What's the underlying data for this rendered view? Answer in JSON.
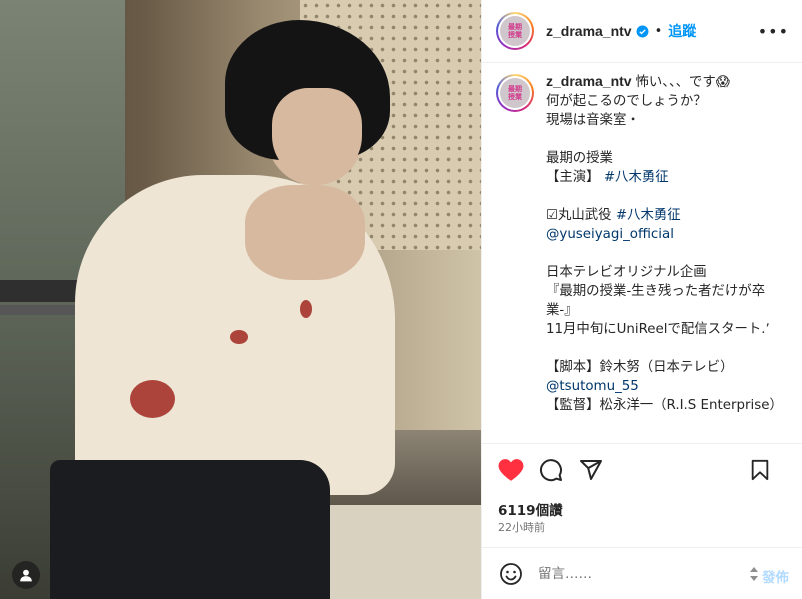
{
  "post": {
    "username": "z_drama_ntv",
    "follow_label": "追蹤",
    "dot": "•",
    "more": "•••",
    "avatar_text": "最期\n授業",
    "caption_lines": [
      {
        "text": "怖い、、、です😱",
        "type": "first"
      },
      {
        "text": "何が起こるのでしょうか？",
        "type": "text"
      },
      {
        "text": "現場は音楽室・",
        "type": "text"
      },
      {
        "text": "",
        "type": "text"
      },
      {
        "text": "最期の授業",
        "type": "text"
      },
      {
        "text": "【主演】",
        "type": "mixed",
        "link": "#八木勇征"
      },
      {
        "text": "",
        "type": "text"
      },
      {
        "text": "☑丸山武役",
        "type": "mixed",
        "link": "#八木勇征"
      },
      {
        "text": "",
        "type": "link",
        "link": "@yuseiyagi_official"
      },
      {
        "text": "",
        "type": "text"
      },
      {
        "text": "日本テレビオリジナル企画",
        "type": "text"
      },
      {
        "text": "『最期の授業-生き残った者だけが卒業-』",
        "type": "text"
      },
      {
        "text": "11月中旬にUniReelで配信スタート.ʼ",
        "type": "text"
      },
      {
        "text": "",
        "type": "text"
      },
      {
        "text": "【脚本】鈴木努（日本テレビ）",
        "type": "text"
      },
      {
        "text": "",
        "type": "link",
        "link": "@tsutomu_55"
      },
      {
        "text": "【監督】松永洋一（R.I.S Enterprise）",
        "type": "text"
      }
    ]
  },
  "stats": {
    "views": "6119個讚",
    "time_ago": "22小時前"
  },
  "comment": {
    "placeholder": "留言……",
    "post_label": "發佈"
  },
  "colors": {
    "accent": "#0095f6",
    "like": "#ff3040",
    "link": "#00376b"
  },
  "icons": [
    "heart-icon",
    "comment-icon",
    "share-icon",
    "bookmark-icon",
    "emoji-icon",
    "verified-icon",
    "user-icon"
  ]
}
